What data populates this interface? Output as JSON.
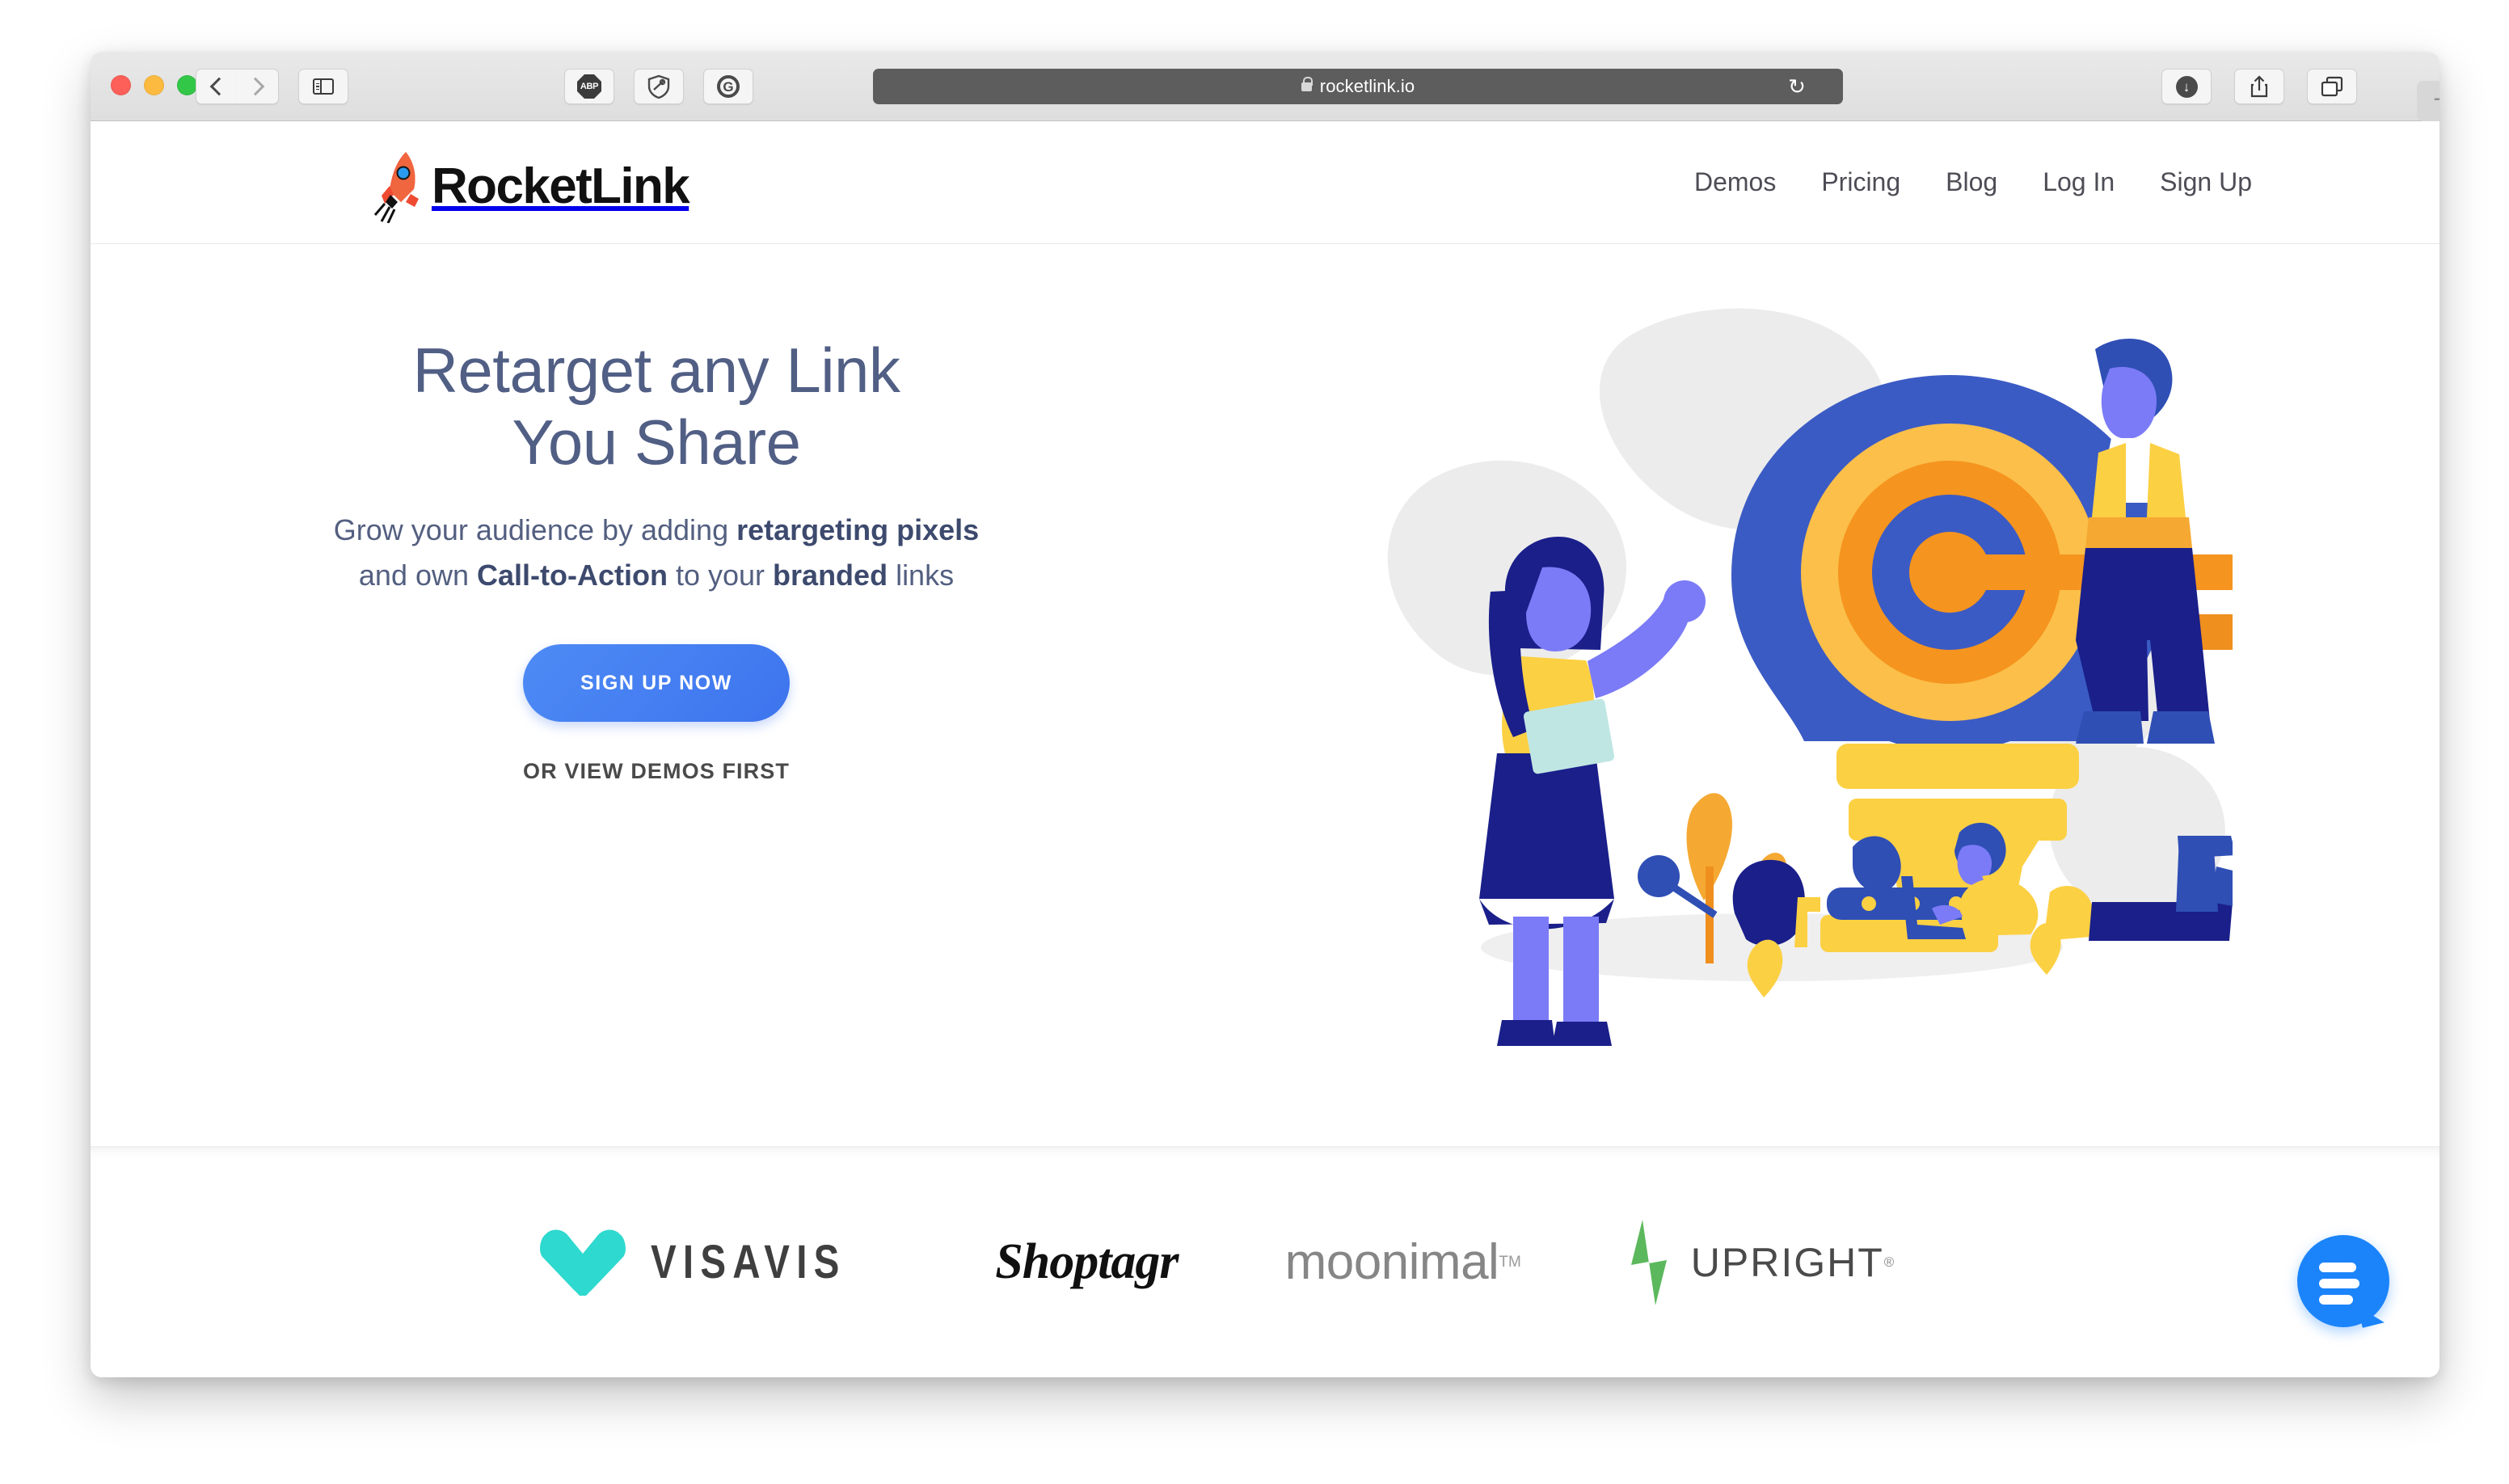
{
  "browser": {
    "url": "rocketlink.io",
    "lock_icon": "lock-icon",
    "reload_glyph": "↻",
    "new_tab_glyph": "+",
    "toolbar_buttons": [
      {
        "name": "back-button",
        "glyph": "‹"
      },
      {
        "name": "forward-button",
        "glyph": "›"
      },
      {
        "name": "sidebar-toggle-button",
        "glyph": "sidebar-icon"
      },
      {
        "name": "adblock-plus-extension",
        "glyph": "ABP"
      },
      {
        "name": "shield-extension",
        "glyph": "shield-icon"
      },
      {
        "name": "grammarly-extension",
        "glyph": "G"
      },
      {
        "name": "downloads-button",
        "glyph": "download-icon"
      },
      {
        "name": "share-button",
        "glyph": "share-icon"
      },
      {
        "name": "tab-overview-button",
        "glyph": "tabs-icon"
      }
    ],
    "extension_labels": {
      "abp": "ABP",
      "grammarly": "G"
    },
    "download_arrow": "↓"
  },
  "site": {
    "brand": "RocketLink",
    "nav": [
      {
        "label": "Demos"
      },
      {
        "label": "Pricing"
      },
      {
        "label": "Blog"
      },
      {
        "label": "Log In"
      },
      {
        "label": "Sign Up"
      }
    ]
  },
  "hero": {
    "title_line1": "Retarget any Link",
    "title_line2": "You Share",
    "sub_parts": {
      "p1": "Grow your audience by adding ",
      "b1": "retargeting pixels",
      "p2": " and own ",
      "b2": "Call-to-Action",
      "p3": " to your ",
      "b3": "branded",
      "p4": " links"
    },
    "cta_primary": "SIGN UP NOW",
    "cta_secondary": "OR VIEW DEMOS FIRST",
    "illustration_name": "target-lightbulb-illustration"
  },
  "logos": [
    {
      "name": "visavis",
      "text": "VISAVIS",
      "mark": "chevron-mark",
      "color": "#2ed9cf"
    },
    {
      "name": "shoptagr",
      "text": "Shoptagr",
      "color": "#101010"
    },
    {
      "name": "moonimal",
      "text": "moonimal",
      "suffix": "TM",
      "color": "#868686"
    },
    {
      "name": "upright",
      "text": "UPRIGHT",
      "suffix": "®",
      "mark": "lightning-mark",
      "color": "#5cb85c"
    }
  ],
  "chat": {
    "label": "chat-bubble"
  },
  "colors": {
    "accent_blue": "#3d74ee",
    "heading_slate": "#515f85",
    "chat_blue": "#1b84fb",
    "illustration_blue": "#3b5bc4",
    "illustration_orange": "#f5a623",
    "illustration_yellow": "#fcd043",
    "illustration_navy": "#1a1f8a"
  }
}
